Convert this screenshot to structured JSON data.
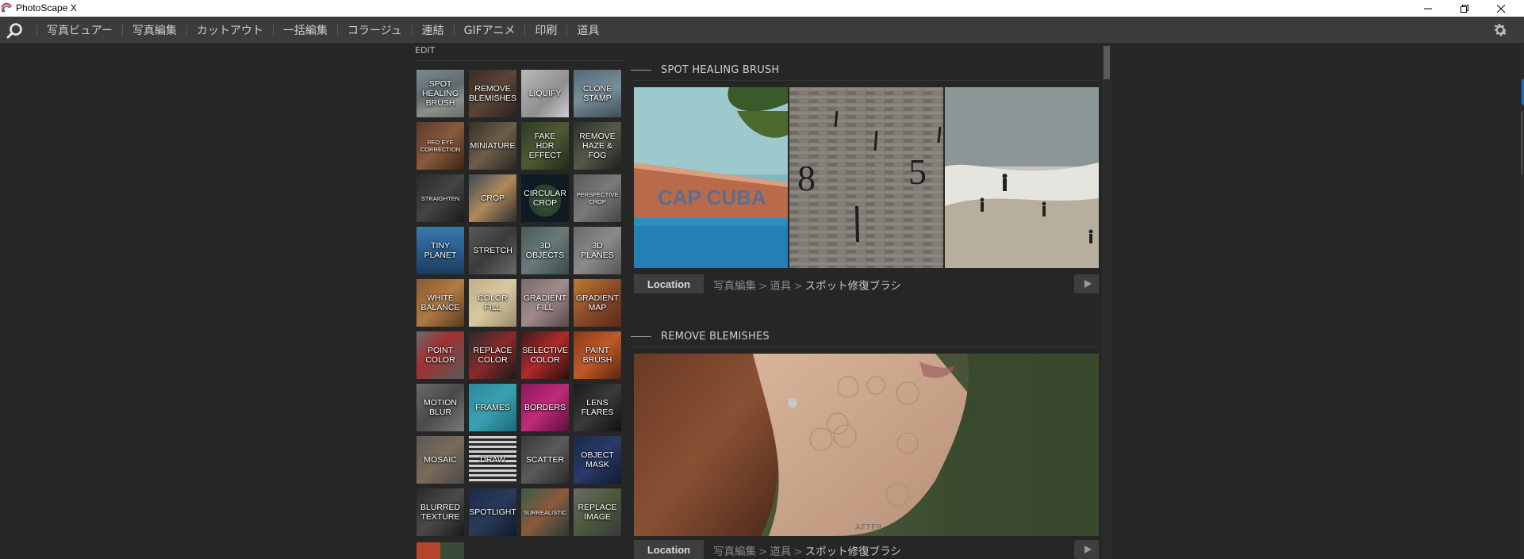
{
  "window": {
    "title": "PhotoScape X",
    "controls": [
      "minimize",
      "restore",
      "close"
    ]
  },
  "menu": {
    "items": [
      "写真ビュアー",
      "写真編集",
      "カットアウト",
      "一括編集",
      "コラージュ",
      "連結",
      "GIFアニメ",
      "印刷",
      "道具"
    ]
  },
  "panel": {
    "edit_label": "EDIT",
    "tools": [
      {
        "label": "SPOT\nHEALING\nBRUSH",
        "bg": "linear-gradient(160deg,#7d8a8f 0%,#5e6a6f 45%,#8c8f8a 70%,#6b6d68 100%)"
      },
      {
        "label": "REMOVE\nBLEMISHES",
        "bg": "linear-gradient(135deg,#3a2c26 0%,#5b4438 50%,#2a211d 100%)"
      },
      {
        "label": "LIQUIFY",
        "bg": "linear-gradient(135deg,#b9b9b9 0%,#8f8f8f 60%,#cfcfcf 100%)"
      },
      {
        "label": "CLONE\nSTAMP",
        "bg": "linear-gradient(160deg,#4f6a78 0%,#7a8f98 50%,#3d4e56 100%)"
      },
      {
        "label": "RED EYE\nCORRECTION",
        "bg": "linear-gradient(135deg,#5a3b2c 0%,#8a5a3c 50%,#3a2418 100%)",
        "small": true
      },
      {
        "label": "MINIATURE",
        "bg": "linear-gradient(135deg,#34302b 0%,#6d5d49 50%,#2a2622 100%)"
      },
      {
        "label": "FAKE\nHDR EFFECT",
        "bg": "linear-gradient(135deg,#2f3a24 0%,#4e5a34 50%,#222a1a 100%)"
      },
      {
        "label": "REMOVE\nHAZE & FOG",
        "bg": "linear-gradient(135deg,#2c2f2a 0%,#545a4a 50%,#1e201c 100%)"
      },
      {
        "label": "STRAIGHTEN",
        "bg": "linear-gradient(135deg,#2a2a2a 0%,#444 50%,#1a1a1a 100%)",
        "small": true
      },
      {
        "label": "CROP",
        "bg": "linear-gradient(135deg,#3c4a5a 0%,#b08a5a 50%,#2c2c30 100%)"
      },
      {
        "label": "CIRCULAR\nCROP",
        "bg": "radial-gradient(circle at 50% 55%,#3e5a3a 0%,#2a4030 45%,#0f1a22 46%,#0f1a22 100%)"
      },
      {
        "label": "PERSPECTIVE\nCROP",
        "bg": "linear-gradient(135deg,#5a5a5a 0%,#7a7a7a 50%,#444 100%)",
        "small": true
      },
      {
        "label": "TINY\nPLANET",
        "bg": "linear-gradient(180deg,#3a78b0 0%,#2a5c8c 50%,#1a3a5c 100%)"
      },
      {
        "label": "STRETCH",
        "bg": "linear-gradient(135deg,#5a5a5a 0%,#3a3a3a 50%,#6a6a6a 100%)"
      },
      {
        "label": "3D\nOBJECTS",
        "bg": "linear-gradient(135deg,#4a5a5a 0%,#6a7a7a 50%,#3a4a4a 100%)"
      },
      {
        "label": "3D\nPLANES",
        "bg": "linear-gradient(135deg,#6a6a6a 0%,#8a8a8a 50%,#555 100%)"
      },
      {
        "label": "WHITE\nBALANCE",
        "bg": "linear-gradient(135deg,#8a5a30 0%,#b07a44 50%,#5a3a20 100%)"
      },
      {
        "label": "COLOR\nFILL",
        "bg": "linear-gradient(135deg,#bfae8a 0%,#d8c8a0 50%,#9a8a6a 100%)"
      },
      {
        "label": "GRADIENT\nFILL",
        "bg": "linear-gradient(135deg,#7a6a6a 0%,#a08a8a 50%,#5a4a4a 100%)"
      },
      {
        "label": "GRADIENT\nMAP",
        "bg": "linear-gradient(135deg,#c07a30 0%,#8a4a2a 50%,#5a2a1a 100%)"
      },
      {
        "label": "POINT\nCOLOR",
        "bg": "linear-gradient(135deg,#6a6a6a 0%,#a03030 40%,#5a5a5a 100%)"
      },
      {
        "label": "REPLACE\nCOLOR",
        "bg": "linear-gradient(135deg,#2a2a2a 0%,#8a2a2a 50%,#1a1a1a 100%)"
      },
      {
        "label": "SELECTIVE\nCOLOR",
        "bg": "linear-gradient(135deg,#3a1a1a 0%,#b02a2a 50%,#2a1010 100%)"
      },
      {
        "label": "PAINT\nBRUSH",
        "bg": "linear-gradient(135deg,#8a3a1a 0%,#c05a2a 50%,#5a2410 100%)"
      },
      {
        "label": "MOTION\nBLUR",
        "bg": "linear-gradient(135deg,#6a6a6a 0%,#4a4a4a 50%,#7a7a7a 100%)"
      },
      {
        "label": "FRAMES",
        "bg": "linear-gradient(135deg,#2a8a9a 0%,#3aa0b0 50%,#1a6a7a 100%)"
      },
      {
        "label": "BORDERS",
        "bg": "linear-gradient(135deg,#8a1a5a 0%,#c02a7a 50%,#5a103a 100%)"
      },
      {
        "label": "LENS\nFLARES",
        "bg": "linear-gradient(135deg,#1a1a1a 0%,#3a3a3a 50%,#101010 100%)"
      },
      {
        "label": "MOSAIC",
        "bg": "linear-gradient(135deg,#5a5a5a 0%,#7a6a5a 50%,#4a4a4a 100%)"
      },
      {
        "label": "DRAW",
        "bg": "repeating-linear-gradient(180deg,#d0d0d0 0px,#d0d0d0 3px,#2a2a2a 3px,#2a2a2a 6px)"
      },
      {
        "label": "SCATTER",
        "bg": "linear-gradient(135deg,#3a3a3a 0%,#5a5a5a 50%,#2a2a2a 100%)"
      },
      {
        "label": "OBJECT\nMASK",
        "bg": "linear-gradient(135deg,#1a2a4a 0%,#2a3a6a 50%,#101a30 100%)"
      },
      {
        "label": "BLURRED\nTEXTURE",
        "bg": "linear-gradient(135deg,#2a2a2a 0%,#4a4a4a 50%,#1a1a1a 100%)"
      },
      {
        "label": "SPOTLIGHT",
        "bg": "linear-gradient(135deg,#1a2a4a 0%,#2a3a5a 50%,#101a2a 100%)"
      },
      {
        "label": "SURREALISTIC",
        "bg": "linear-gradient(135deg,#3a5a4a 0%,#8a5a3a 50%,#2a3a3a 100%)",
        "small": true
      },
      {
        "label": "REPLACE\nIMAGE",
        "bg": "linear-gradient(135deg,#6a6a6a 0%,#4a5a3a 50%,#3a3a3a 100%)"
      }
    ]
  },
  "sections": [
    {
      "title": "SPOT HEALING BRUSH",
      "location_label": "Location",
      "breadcrumb": [
        "写真編集",
        "道具",
        "スポット修復ブラシ"
      ],
      "images": [
        "beach-cuba-sign",
        "brick-wall-numbers",
        "beach-people"
      ]
    },
    {
      "title": "REMOVE BLEMISHES",
      "location_label": "Location",
      "breadcrumb": [
        "写真編集",
        "道具",
        "スポット修復ブラシ"
      ],
      "after_label": "AFTER",
      "images": [
        "portrait-woman-blemishes"
      ]
    }
  ],
  "colors": {
    "background": "#262626",
    "menubar": "#3c3c3c",
    "titlebar": "#ffffff",
    "accent": "#1e6fb8"
  }
}
